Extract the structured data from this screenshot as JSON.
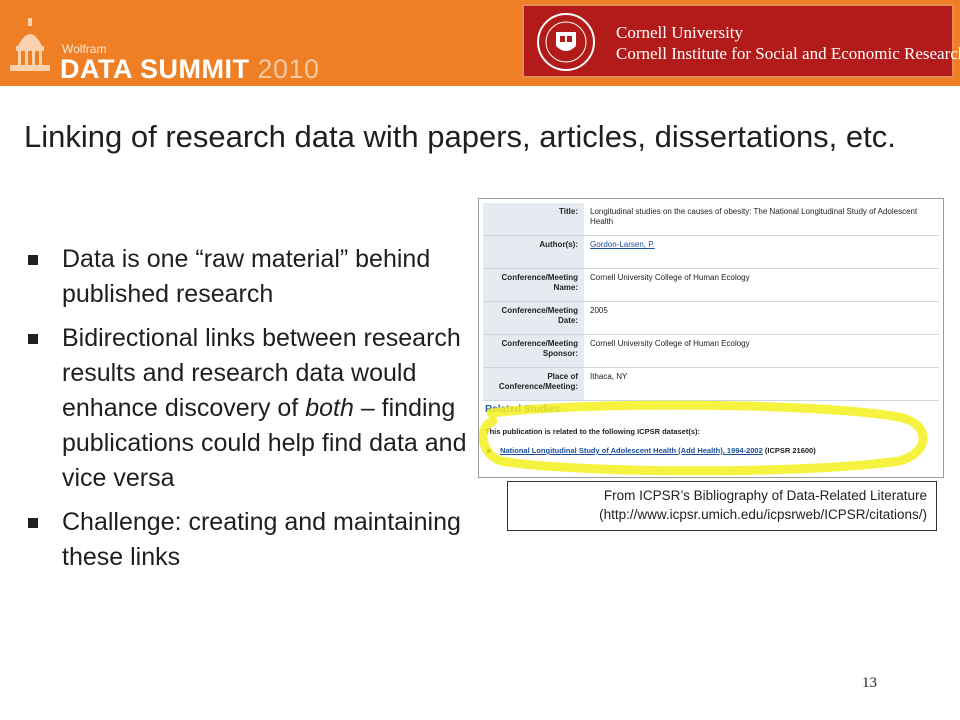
{
  "header": {
    "wolfram": "Wolfram",
    "summit": "DATA SUMMIT",
    "year": "2010",
    "university": "Cornell University",
    "institute": "Cornell Institute for Social and Economic Research",
    "colors": {
      "orange": "#ee7f24",
      "cornell_red": "#b31b1b"
    }
  },
  "title": "Linking of research data with papers, articles, dissertations, etc.",
  "bullets": [
    {
      "parts": [
        "Data is one “raw material” behind published research"
      ]
    },
    {
      "before": "Bidirectional links between research results and research data would enhance discovery of ",
      "emph": "both",
      "after": " – finding publications could help find data and vice versa"
    },
    {
      "parts": [
        "Challenge: creating and maintaining these links"
      ]
    }
  ],
  "bibliography": {
    "records": [
      {
        "label": "Title:",
        "value": "Longitudinal studies on the causes of obesity: The National Longitudinal Study of Adolescent Health"
      },
      {
        "label": "Author(s):",
        "value": "Gordon-Larsen, P."
      },
      {
        "label": "Conference/Meeting Name:",
        "value": "Cornell University College of Human Ecology"
      },
      {
        "label": "Conference/Meeting Date:",
        "value": "2005"
      },
      {
        "label": "Conference/Meeting Sponsor:",
        "value": "Cornell University College of Human Ecology"
      },
      {
        "label": "Place of Conference/Meeting:",
        "value": "Ithaca, NY"
      }
    ],
    "related_heading": "Related Studies",
    "related_text": "This publication is related to the following ICPSR dataset(s):",
    "related_link": "National Longitudinal Study of Adolescent Health (Add Health), 1994-2002",
    "related_code": "(ICPSR 21600)"
  },
  "caption": {
    "line1": "From ICPSR’s Bibliography of Data-Related Literature",
    "line2": "(http://www.icpsr.umich.edu/icpsrweb/ICPSR/citations/)"
  },
  "page_number": "13"
}
